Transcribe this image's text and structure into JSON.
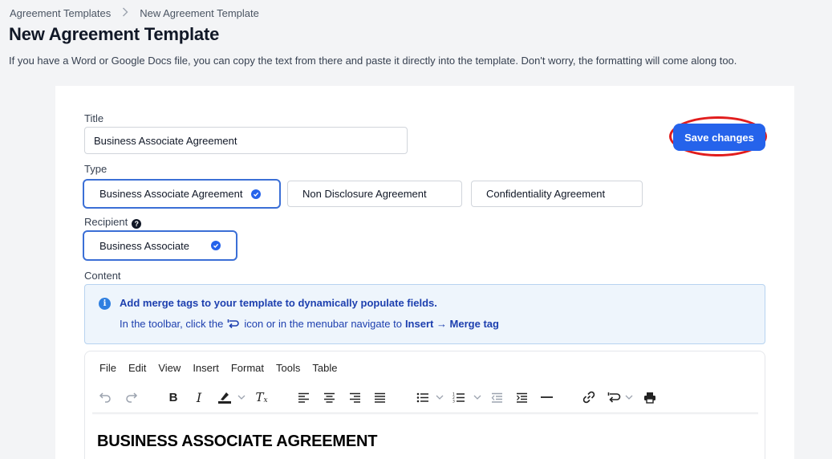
{
  "breadcrumb": {
    "parent": "Agreement Templates",
    "current": "New Agreement Template"
  },
  "page": {
    "title": "New Agreement Template",
    "subtitle": "If you have a Word or Google Docs file, you can copy the text from there and paste it directly into the template. Don't worry, the formatting will come along too."
  },
  "form": {
    "title_label": "Title",
    "title_value": "Business Associate Agreement",
    "save_label": "Save changes",
    "type_label": "Type",
    "types": [
      {
        "label": "Business Associate Agreement",
        "selected": true
      },
      {
        "label": "Non Disclosure Agreement",
        "selected": false
      },
      {
        "label": "Confidentiality Agreement",
        "selected": false
      }
    ],
    "recipient_label": "Recipient",
    "recipient": {
      "label": "Business Associate",
      "selected": true
    },
    "content_label": "Content"
  },
  "info": {
    "line1": "Add merge tags to your template to dynamically populate fields.",
    "line2_prefix": "In the toolbar, click the",
    "line2_middle": "icon or in the menubar navigate to",
    "line2_path": "Insert → Merge tag"
  },
  "editor": {
    "menus": [
      "File",
      "Edit",
      "View",
      "Insert",
      "Format",
      "Tools",
      "Table"
    ],
    "heading": "BUSINESS ASSOCIATE AGREEMENT"
  },
  "colors": {
    "accent": "#2563eb",
    "highlight_ring": "#e11d1d",
    "info_bg": "#eef5fc",
    "info_text": "#1e40af"
  }
}
